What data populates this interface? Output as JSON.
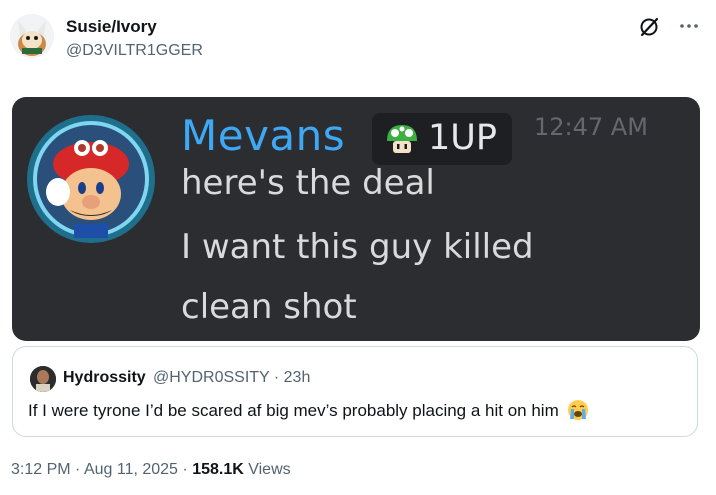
{
  "post": {
    "author_name": "Susie/Ivory",
    "author_handle": "@D3VILTR1GGER",
    "timestamp": "3:12 PM",
    "date": "Aug 11, 2025",
    "separator": "·",
    "views_count": "158.1K",
    "views_label": "Views"
  },
  "media": {
    "username": "Mevans",
    "badge_label": "1UP",
    "time": "12:47 AM",
    "lines": [
      "here's the deal",
      "I want this guy killed",
      "clean shot"
    ]
  },
  "quote": {
    "author_name": "Hydrossity",
    "author_handle": "@HYDR0SSITY",
    "time": "23h",
    "text": "If I were tyrone I’d be scared af big mev’s probably placing a hit on him"
  },
  "icons": {
    "grok": "grok-icon",
    "more": "more-icon",
    "crying": "loudly-crying-face-emoji",
    "mushroom": "1up-mushroom-icon"
  },
  "colors": {
    "username_blue": "#3ea8f5",
    "discord_bg": "#2b2d31",
    "secondary_text": "#536471"
  }
}
